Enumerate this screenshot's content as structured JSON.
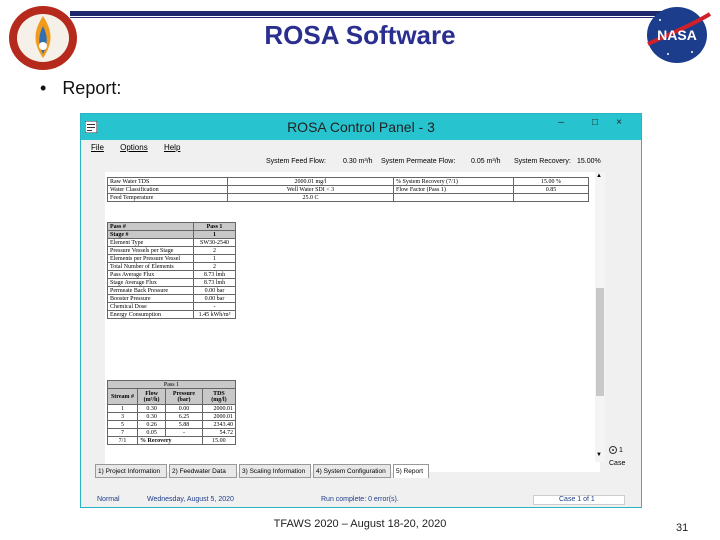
{
  "slide": {
    "title": "ROSA Software",
    "bullet": "Report:",
    "footer": "TFAWS 2020 – August 18-20, 2020",
    "page_number": "31",
    "logo_left_text": "TFAWS",
    "logo_right_text": "NASA",
    "colors": {
      "title": "#2a2f8f",
      "window_title": "#27c3cf",
      "status_text": "#1f3d8a"
    }
  },
  "window": {
    "title": "ROSA Control Panel - 3",
    "minimize": "–",
    "maximize": "□",
    "close": "×",
    "menu": [
      "File",
      "Options",
      "Help"
    ],
    "summary": {
      "feed_flow_label": "System Feed Flow:",
      "feed_flow_value": "0.30 m³/h",
      "permeate_flow_label": "System Permeate Flow:",
      "permeate_flow_value": "0.05 m³/h",
      "recovery_label": "System Recovery:",
      "recovery_value": "15.00%"
    },
    "top_table": [
      [
        "Raw Water TDS",
        "2000.01 mg/l",
        "% System Recovery (7/1)",
        "15.00 %"
      ],
      [
        "Water Classification",
        "Well Water SDI < 3",
        "Flow Factor (Pass 1)",
        "0.85"
      ],
      [
        "Feed Temperature",
        "25.0 C",
        "",
        ""
      ]
    ],
    "pass_table": {
      "headers": [
        "Pass #",
        "Pass 1"
      ],
      "rows": [
        [
          "Stage #",
          "1"
        ],
        [
          "Element Type",
          "SW30-2540"
        ],
        [
          "Pressure Vessels per Stage",
          "2"
        ],
        [
          "Elements per Pressure Vessel",
          "1"
        ],
        [
          "Total Number of Elements",
          "2"
        ],
        [
          "Pass Average Flux",
          "8.73 lmh"
        ],
        [
          "Stage Average Flux",
          "8.73 lmh"
        ],
        [
          "Permeate Back Pressure",
          "0.00 bar"
        ],
        [
          "Booster Pressure",
          "0.00 bar"
        ],
        [
          "Chemical Dose",
          "-"
        ],
        [
          "Energy Consumption",
          "1.45 kWh/m³"
        ]
      ]
    },
    "stream_table": {
      "group_header": "Pass 1",
      "headers": [
        "Stream #",
        "Flow\n(m³/h)",
        "Pressure\n(bar)",
        "TDS\n(mg/l)"
      ],
      "rows": [
        [
          "1",
          "0.30",
          "0.00",
          "2000.01"
        ],
        [
          "3",
          "0.30",
          "6.25",
          "2000.01"
        ],
        [
          "5",
          "0.26",
          "5.88",
          "2343.40"
        ],
        [
          "7",
          "0.05",
          "-",
          "54.72"
        ]
      ],
      "recovery_row": [
        "7/1",
        "% Recovery",
        "15.00"
      ]
    },
    "tabs": [
      "1) Project Information",
      "2) Feedwater Data",
      "3) Scaling Information",
      "4) System Configuration",
      "5) Report"
    ],
    "case_radio_label": "1",
    "case_label": "Case",
    "status": {
      "mode": "Normal",
      "date": "Wednesday, August 5, 2020",
      "run": "Run complete: 0 error(s).",
      "case": "Case 1 of 1"
    }
  }
}
